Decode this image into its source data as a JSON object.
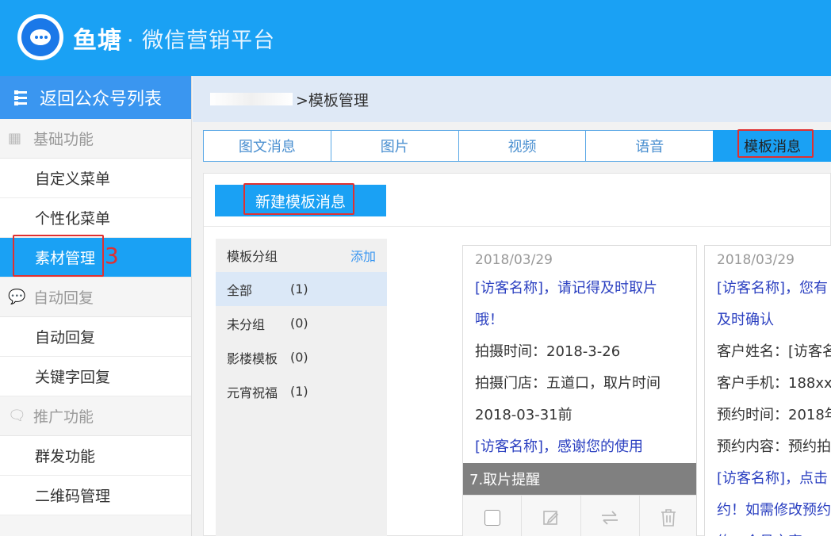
{
  "header": {
    "brand": "鱼塘",
    "brand_sub": "· 微信营销平台"
  },
  "sidebar": {
    "back_label": "返回公众号列表",
    "sections": [
      {
        "title": "基础功能",
        "items": [
          "自定义菜单",
          "个性化菜单",
          "素材管理"
        ]
      },
      {
        "title": "自动回复",
        "items": [
          "自动回复",
          "关键字回复"
        ]
      },
      {
        "title": "推广功能",
        "items": [
          "群发功能",
          "二维码管理"
        ]
      }
    ],
    "step_number": "3"
  },
  "breadcrumb": {
    "current": ">模板管理"
  },
  "tabs": [
    "图文消息",
    "图片",
    "视频",
    "语音",
    "模板消息"
  ],
  "content": {
    "new_button": "新建模板消息",
    "groups_title": "模板分组",
    "groups_add": "添加",
    "groups": [
      {
        "name": "全部",
        "count": "(1)"
      },
      {
        "name": "未分组",
        "count": "(0)"
      },
      {
        "name": "影楼模板",
        "count": "(0)"
      },
      {
        "name": "元宵祝福",
        "count": "(1)"
      }
    ],
    "cards": [
      {
        "date": "2018/03/29",
        "lines": [
          {
            "text": "[访客名称]，请记得及时取片",
            "blue": true
          },
          {
            "text": "哦！",
            "blue": true
          },
          {
            "text": "拍摄时间：2018-3-26",
            "blue": false
          },
          {
            "text": "拍摄门店：五道口，取片时间",
            "blue": false
          },
          {
            "text": "2018-03-31前",
            "blue": false
          },
          {
            "text": "[访客名称]，感谢您的使用",
            "blue": true
          }
        ],
        "title": "7.取片提醒"
      },
      {
        "date": "2018/03/29",
        "lines": [
          {
            "text": "[访客名称]，您有",
            "blue": true
          },
          {
            "text": "及时确认",
            "blue": true
          },
          {
            "text": "客户姓名：[访客名",
            "blue": false
          },
          {
            "text": "客户手机：188xx",
            "blue": false
          },
          {
            "text": "预约时间：2018年",
            "blue": false
          },
          {
            "text": "预约内容：预约拍",
            "blue": false
          },
          {
            "text": "[访客名称]，点击",
            "blue": true
          },
          {
            "text": "约！如需修改预约",
            "blue": true
          },
          {
            "text": "约，会员之家",
            "blue": true
          }
        ]
      }
    ]
  },
  "colors": {
    "primary": "#1aa1f4",
    "highlight": "#e03030"
  }
}
